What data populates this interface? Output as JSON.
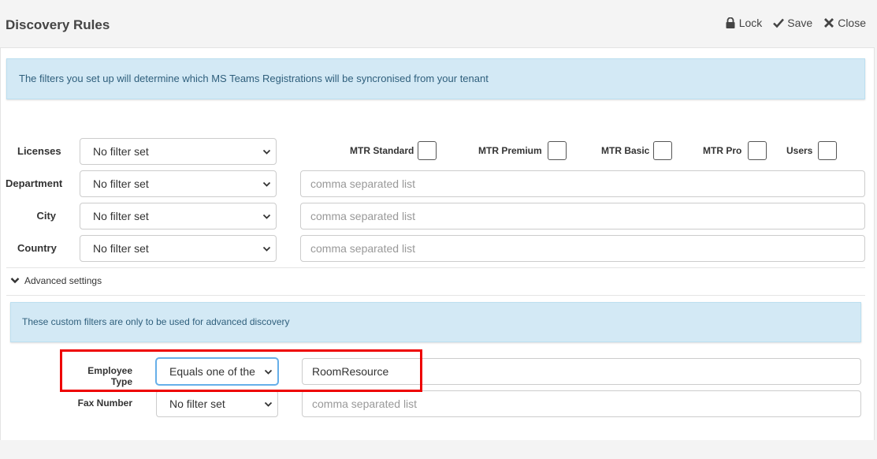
{
  "header": {
    "title": "Discovery Rules",
    "lock_label": "Lock",
    "save_label": "Save",
    "close_label": "Close"
  },
  "info_alert": "The filters you set up will determine which MS Teams Registrations will be syncronised from your tenant",
  "filters": {
    "licenses": {
      "label": "Licenses",
      "select": "No filter set"
    },
    "department": {
      "label": "Department",
      "select": "No filter set",
      "placeholder": "comma separated list"
    },
    "city": {
      "label": "City",
      "select": "No filter set",
      "placeholder": "comma separated list"
    },
    "country": {
      "label": "Country",
      "select": "No filter set",
      "placeholder": "comma separated list"
    }
  },
  "license_types": [
    "MTR Standard",
    "MTR Premium",
    "MTR Basic",
    "MTR Pro",
    "Users"
  ],
  "advanced": {
    "toggle_label": "Advanced settings",
    "alert": "These custom filters are only to be used for advanced discovery",
    "employee_type": {
      "label": "Employee Type",
      "select": "Equals one of the fc",
      "value": "RoomResource"
    },
    "fax_number": {
      "label": "Fax Number",
      "select": "No filter set",
      "placeholder": "comma separated list"
    }
  },
  "colors": {
    "highlight": "#e00000",
    "alert_bg": "#d3e9f5",
    "alert_text": "#2f5f7c"
  }
}
